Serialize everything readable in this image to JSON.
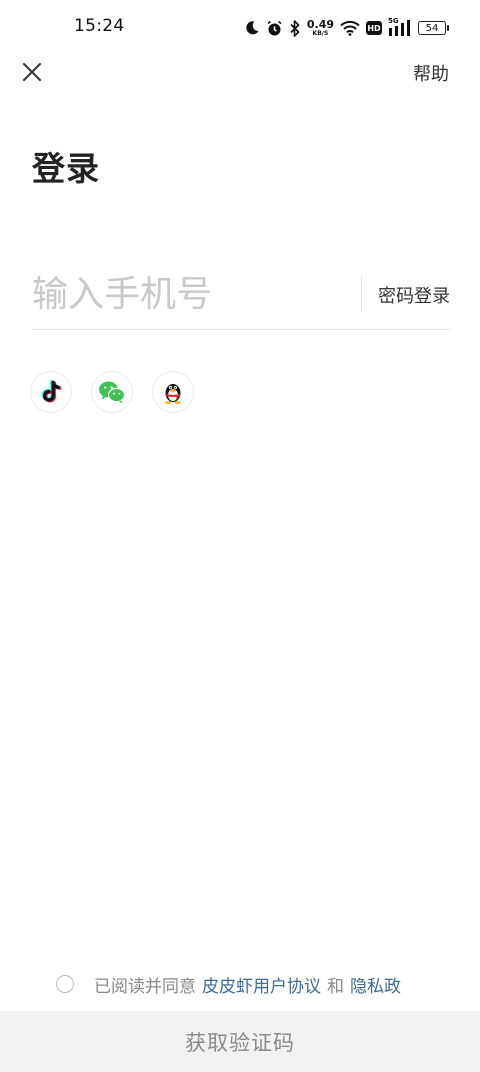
{
  "status_bar": {
    "time": "15:24",
    "net_speed_value": "0.49",
    "net_speed_unit": "KB/S",
    "hd_label": "HD",
    "network_label": "5G",
    "battery": "54",
    "icons": [
      "moon-icon",
      "alarm-icon",
      "bluetooth-icon",
      "wifi-icon",
      "hd-icon",
      "signal-icon",
      "battery-icon"
    ]
  },
  "header": {
    "close_icon": "close-icon",
    "help_label": "帮助"
  },
  "title": "登录",
  "phone": {
    "placeholder": "输入手机号",
    "value": "",
    "password_login_label": "密码登录"
  },
  "social": [
    {
      "name": "douyin",
      "icon": "douyin-icon"
    },
    {
      "name": "wechat",
      "icon": "wechat-icon"
    },
    {
      "name": "qq",
      "icon": "qq-icon"
    }
  ],
  "agreement": {
    "prefix": "已阅读并同意",
    "user_agreement": "皮皮虾用户协议",
    "and": "和",
    "privacy_policy": "隐私政",
    "checked": false
  },
  "submit": {
    "label": "获取验证码"
  },
  "colors": {
    "link": "#3d6a96",
    "button_bg": "#f2f2f2",
    "button_text": "#8a8a8a",
    "wechat_green": "#3dc254"
  }
}
